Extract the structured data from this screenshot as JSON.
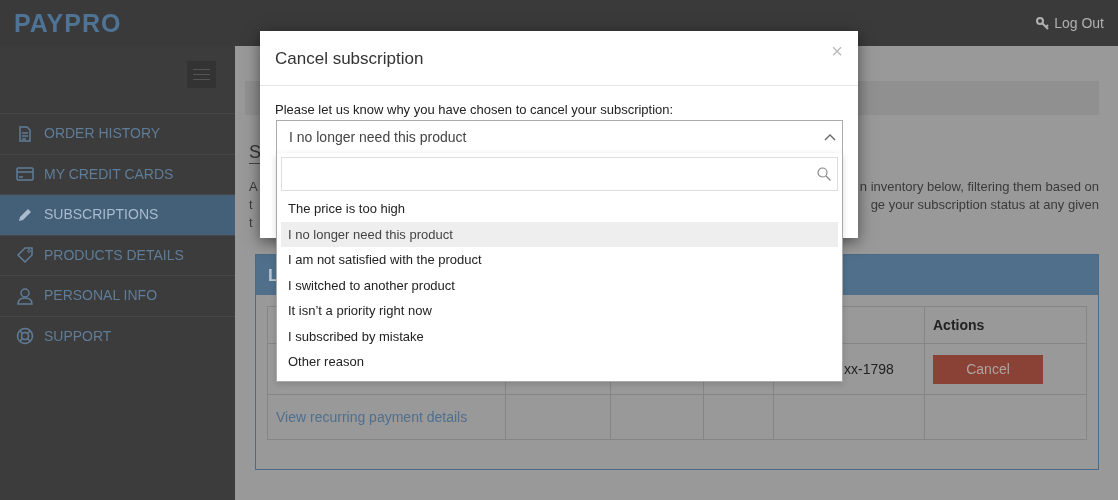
{
  "header": {
    "logo": "PAYPRO",
    "logout": "Log Out"
  },
  "sidebar": {
    "items": [
      {
        "label": "ORDER HISTORY",
        "selected": false
      },
      {
        "label": "MY CREDIT CARDS",
        "selected": false
      },
      {
        "label": "SUBSCRIPTIONS",
        "selected": true
      },
      {
        "label": "PRODUCTS DETAILS",
        "selected": false
      },
      {
        "label": "PERSONAL INFO",
        "selected": false
      },
      {
        "label": "SUPPORT",
        "selected": false
      }
    ]
  },
  "page": {
    "heading": "S",
    "intro_left": [
      "A",
      "t",
      "t"
    ],
    "intro_right": [
      "n inventory below, filtering them based on",
      "ge your subscription status at any given"
    ],
    "panel": {
      "title": "L",
      "actions_column": "Actions",
      "rows": [
        {
          "column_5": "xx-1798",
          "action": "Cancel"
        },
        {
          "link": "View recurring payment details"
        }
      ]
    }
  },
  "modal": {
    "title": "Cancel subscription",
    "close": "×",
    "prompt": "Please let us know why you have chosen to cancel your subscription:",
    "select": {
      "value": "I no longer need this product",
      "expanded": true,
      "options": [
        {
          "label": "The price is too high",
          "selected": false
        },
        {
          "label": "I no longer need this product",
          "selected": true
        },
        {
          "label": "I am not satisfied with the product",
          "selected": false
        },
        {
          "label": "I switched to another product",
          "selected": false
        },
        {
          "label": "It isn’t a priority right now",
          "selected": false
        },
        {
          "label": "I subscribed by mistake",
          "selected": false
        },
        {
          "label": "Other reason",
          "selected": false
        }
      ]
    }
  }
}
